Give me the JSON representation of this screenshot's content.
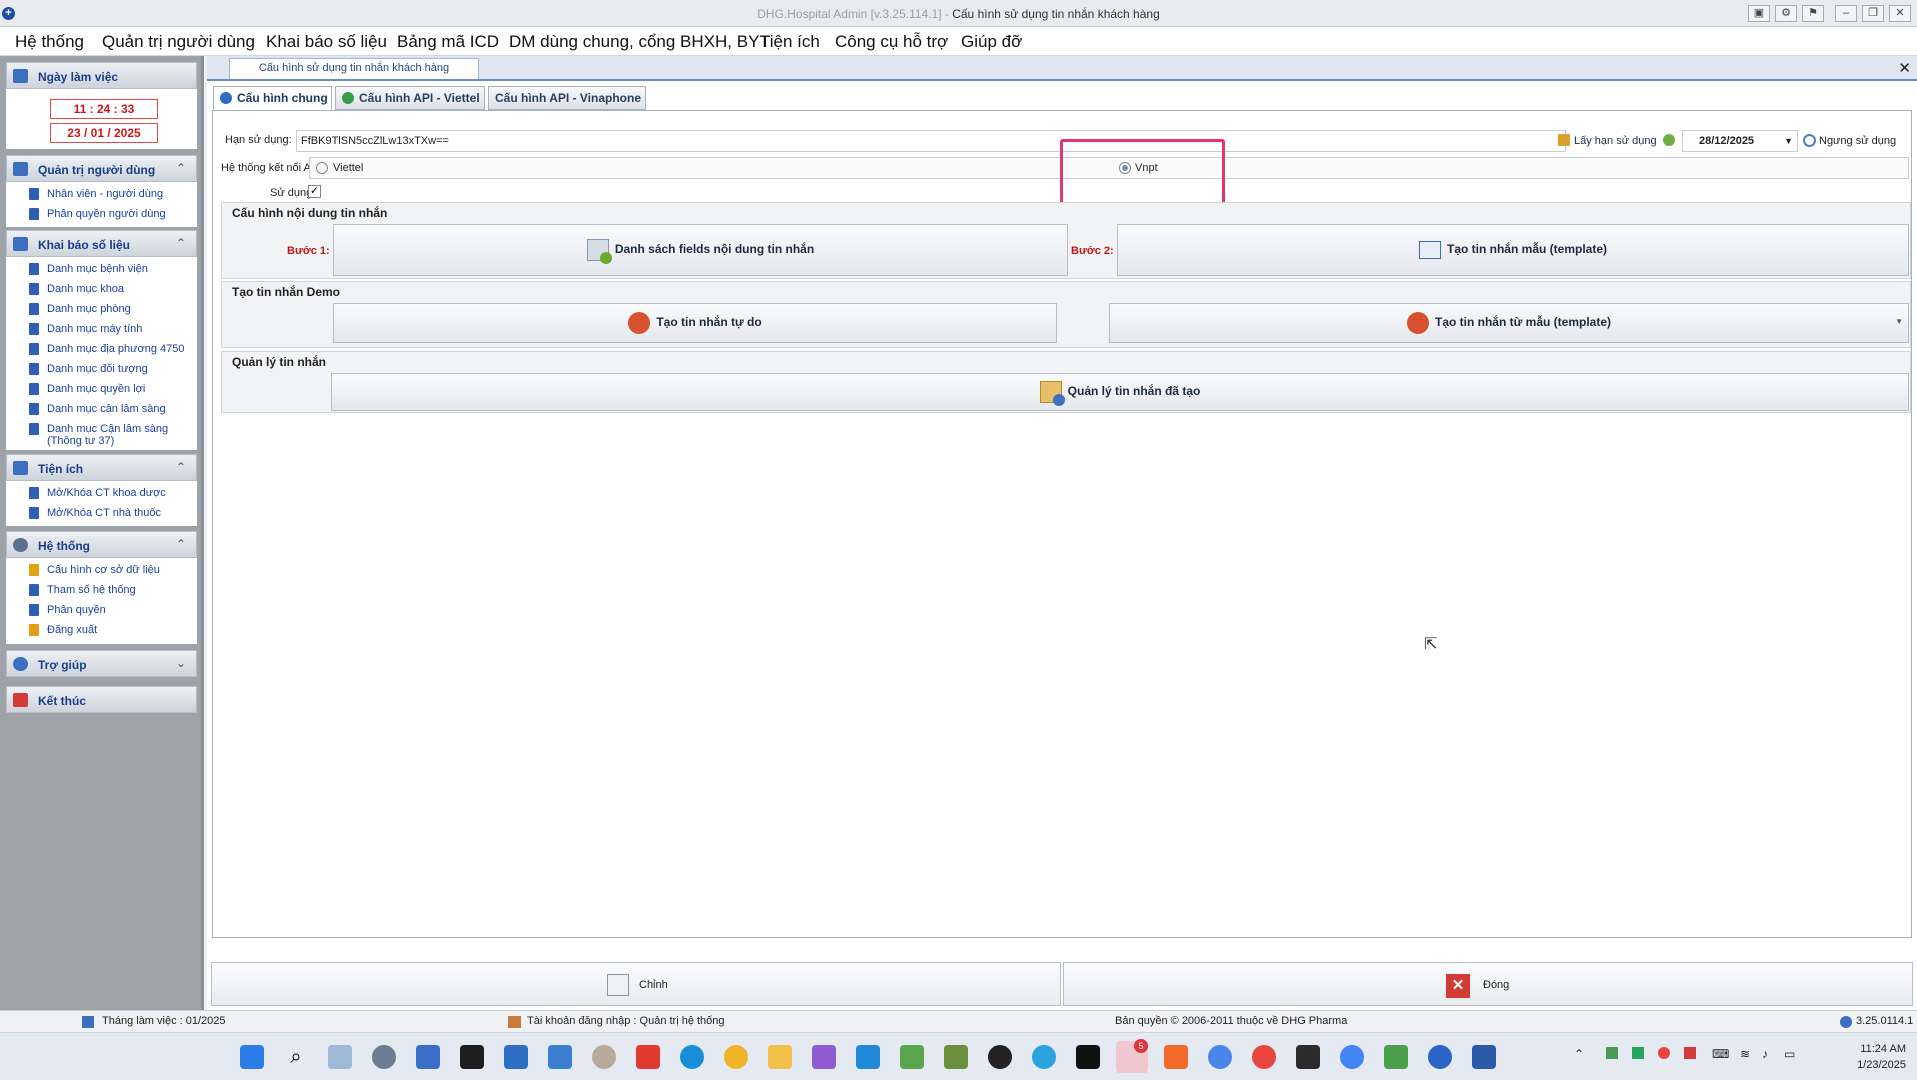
{
  "window": {
    "app_name": "DHG.Hospital Admin [v.3.25.114.1]",
    "separator": " - ",
    "doc_title": "Cấu hình sử dụng tin nhắn khách hàng"
  },
  "menu": [
    "Hệ thống",
    "Quản trị người dùng",
    "Khai báo số liệu",
    "Bảng mã ICD",
    "DM dùng chung, cổng BHXH, BYT",
    "Tiện ích",
    "Công cụ hỗ trợ",
    "Giúp đỡ"
  ],
  "sidebar": {
    "work_date": {
      "header": "Ngày làm việc",
      "time": "11 : 24 : 33",
      "date": "23 / 01 / 2025"
    },
    "user_admin": {
      "header": "Quản trị người dùng",
      "items": [
        "Nhân viên - người dùng",
        "Phân quyền người dùng"
      ]
    },
    "data_setup": {
      "header": "Khai báo số liệu",
      "items": [
        "Danh mục bệnh viện",
        "Danh mục khoa",
        "Danh mục phòng",
        "Danh mục máy tính",
        "Danh mục địa phương 4750",
        "Danh mục đối tượng",
        "Danh mục quyền lợi",
        "Danh mục cận lâm sàng",
        "Danh mục Cận lâm sàng (Thông  tư 37)"
      ]
    },
    "utilities": {
      "header": "Tiện ích",
      "items": [
        "Mở/Khóa CT khoa dược",
        "Mở/Khóa CT nhà thuốc"
      ]
    },
    "system": {
      "header": "Hệ thống",
      "items": [
        "Cấu hình cơ sở dữ liệu",
        "Tham số hệ thống",
        "Phân quyền",
        "Đăng xuất"
      ]
    },
    "help": {
      "header": "Trợ giúp"
    },
    "exit": {
      "header": "Kết thúc"
    }
  },
  "doc_tab": "Cấu hình sử dụng tin nhắn khách hàng",
  "tabs": [
    "Cấu hình chung",
    "Cấu hình API - Viettel",
    "Cấu hình API - Vinaphone"
  ],
  "form": {
    "license_label": "Hạn sử dụng:",
    "license_key": "FfBK9TlSN5ccZlLw13xTXw==",
    "get_license_btn": "Lấy hạn sử dụng",
    "expiry_date": "28/12/2025",
    "stop_btn": "Ngưng sử dụng",
    "api_label": "Hệ thống kết nối API:",
    "api_options": [
      "Viettel",
      "Vnpt"
    ],
    "api_selected": "Vnpt",
    "use_label": "Sử dụng:",
    "use_checked": true
  },
  "sections": {
    "content": {
      "title": "Cấu hình nội dung tin nhắn",
      "step1": "Bước 1:",
      "btn1": "Danh sách fields nội dung tin nhắn",
      "step2": "Bước 2:",
      "btn2": "Tạo tin nhắn mẫu (template)"
    },
    "demo": {
      "title": "Tạo tin nhắn Demo",
      "btn1": "Tạo tin nhắn tự do",
      "btn2": "Tạo tin nhắn từ mẫu (template)"
    },
    "manage": {
      "title": "Quản lý tin nhắn",
      "btn": "Quản lý tin nhắn đã tạo"
    }
  },
  "bottom": {
    "edit": "Chỉnh",
    "close": "Đóng"
  },
  "status": {
    "month": "Tháng làm việc : 01/2025",
    "account": "Tài khoản đăng nhập : Quản trị hệ thống",
    "copyright": "Bản quyền © 2006-2011 thuộc về DHG Pharma",
    "version": "3.25.0114.1"
  },
  "taskbar": {
    "time": "11:24 AM",
    "date": "1/23/2025",
    "badge": "5"
  },
  "colors": {
    "accent": "#1b3e8a",
    "step_red": "#c21616",
    "highlight": "#e0386c"
  }
}
